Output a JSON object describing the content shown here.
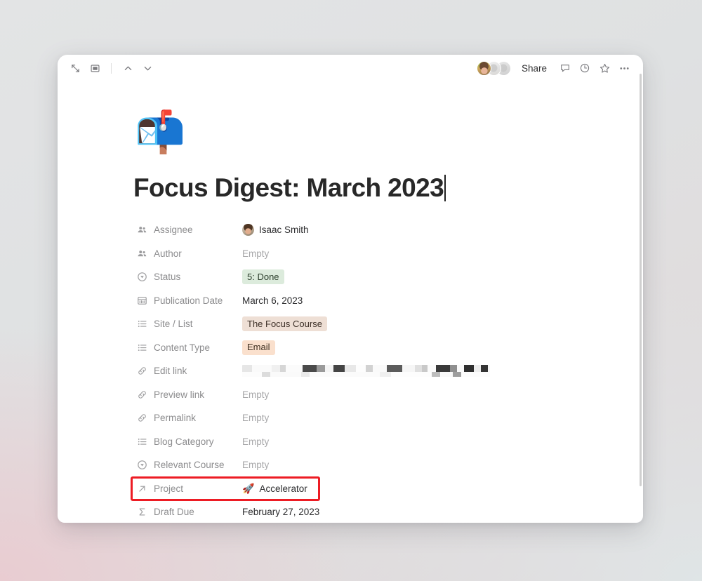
{
  "window": {
    "toolbar": {
      "expand_icon": "expand-arrows-icon",
      "panel_icon": "sidebar-panel-icon",
      "prev_icon": "chevron-up-icon",
      "next_icon": "chevron-down-icon",
      "share_label": "Share",
      "comment_icon": "comment-icon",
      "history_icon": "clock-history-icon",
      "favorite_icon": "star-icon",
      "more_icon": "more-options-icon",
      "avatars": [
        "avatar-photo",
        "avatar-placeholder",
        "avatar-placeholder"
      ]
    }
  },
  "page": {
    "emoji": "📬",
    "title": "Focus Digest: March 2023"
  },
  "properties": [
    {
      "icon": "people-icon",
      "label": "Assignee",
      "value": "Isaac Smith",
      "type": "person",
      "empty": false
    },
    {
      "icon": "people-icon",
      "label": "Author",
      "value": "Empty",
      "type": "text",
      "empty": true
    },
    {
      "icon": "select-circle-icon",
      "label": "Status",
      "value": "5: Done",
      "type": "tag-green",
      "empty": false
    },
    {
      "icon": "calendar-icon",
      "label": "Publication Date",
      "value": "March 6, 2023",
      "type": "text",
      "empty": false
    },
    {
      "icon": "multi-select-list-icon",
      "label": "Site / List",
      "value": "The Focus Course",
      "type": "tag-brown",
      "empty": false
    },
    {
      "icon": "multi-select-list-icon",
      "label": "Content Type",
      "value": "Email",
      "type": "tag-orange",
      "empty": false
    },
    {
      "icon": "link-icon",
      "label": "Edit link",
      "value": "",
      "type": "redacted",
      "empty": false
    },
    {
      "icon": "link-icon",
      "label": "Preview link",
      "value": "Empty",
      "type": "text",
      "empty": true
    },
    {
      "icon": "link-icon",
      "label": "Permalink",
      "value": "Empty",
      "type": "text",
      "empty": true
    },
    {
      "icon": "multi-select-list-icon",
      "label": "Blog Category",
      "value": "Empty",
      "type": "text",
      "empty": true
    },
    {
      "icon": "select-circle-icon",
      "label": "Relevant Course",
      "value": "Empty",
      "type": "text",
      "empty": true
    },
    {
      "icon": "relation-arrow-icon",
      "label": "Project",
      "value": "Accelerator",
      "value_emoji": "🚀",
      "type": "relation",
      "empty": false,
      "highlighted": true
    },
    {
      "icon": "formula-sigma-icon",
      "label": "Draft Due",
      "value": "February 27, 2023",
      "type": "text",
      "empty": false
    }
  ],
  "annotation": {
    "highlight_color": "#ed1c24",
    "target": "Project"
  }
}
